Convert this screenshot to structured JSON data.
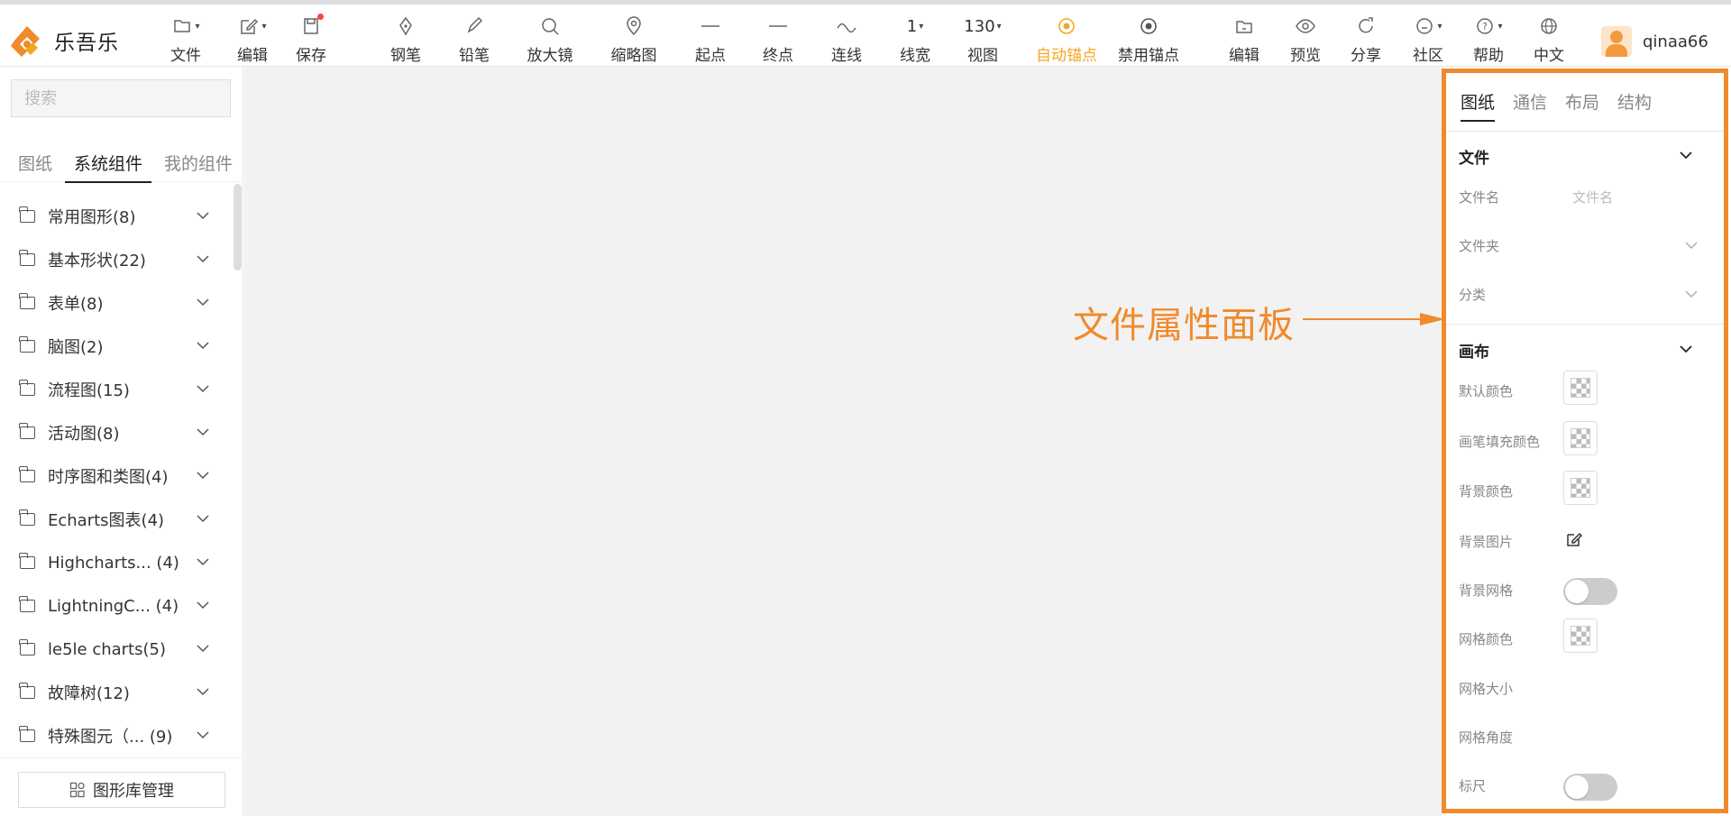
{
  "app": {
    "name": "乐吾乐"
  },
  "toolbar": {
    "file": "文件",
    "edit": "编辑",
    "save": "保存",
    "pen": "钢笔",
    "pencil": "铅笔",
    "magnifier": "放大镜",
    "thumbnail": "缩略图",
    "start": "起点",
    "end": "终点",
    "connect": "连线",
    "line_width_value": "1",
    "line_width": "线宽",
    "zoom_value": "130",
    "view": "视图",
    "auto_anchor": "自动锚点",
    "disable_anchor": "禁用锚点",
    "edit2": "编辑",
    "preview": "预览",
    "share": "分享",
    "community": "社区",
    "help": "帮助",
    "language": "中文",
    "username": "qinaa66"
  },
  "sidebar": {
    "search_placeholder": "搜索",
    "tabs": [
      "图纸",
      "系统组件",
      "我的组件"
    ],
    "active_tab": 1,
    "categories": [
      "常用图形(8)",
      "基本形状(22)",
      "表单(8)",
      "脑图(2)",
      "流程图(15)",
      "活动图(8)",
      "时序图和类图(4)",
      "Echarts图表(4)",
      "Highcharts... (4)",
      "LightningC... (4)",
      "le5le charts(5)",
      "故障树(12)",
      "特殊图元（... (9)"
    ],
    "library_button": "图形库管理"
  },
  "annotation": {
    "label": "文件属性面板",
    "color": "#f08a2c"
  },
  "panel": {
    "tabs": [
      "图纸",
      "通信",
      "布局",
      "结构"
    ],
    "active_tab": 0,
    "file_section": {
      "title": "文件",
      "filename_label": "文件名",
      "filename_placeholder": "文件名",
      "folder_label": "文件夹",
      "category_label": "分类"
    },
    "canvas_section": {
      "title": "画布",
      "default_color": "默认颜色",
      "pen_fill_color": "画笔填充颜色",
      "bg_color": "背景颜色",
      "bg_image": "背景图片",
      "bg_grid": "背景网格",
      "grid_color": "网格颜色",
      "grid_size": "网格大小",
      "grid_angle": "网格角度",
      "ruler": "标尺"
    }
  },
  "colors": {
    "accent": "#f5a623",
    "highlight_border": "#f08a2c",
    "canvas_bg": "#f2f2f2"
  }
}
